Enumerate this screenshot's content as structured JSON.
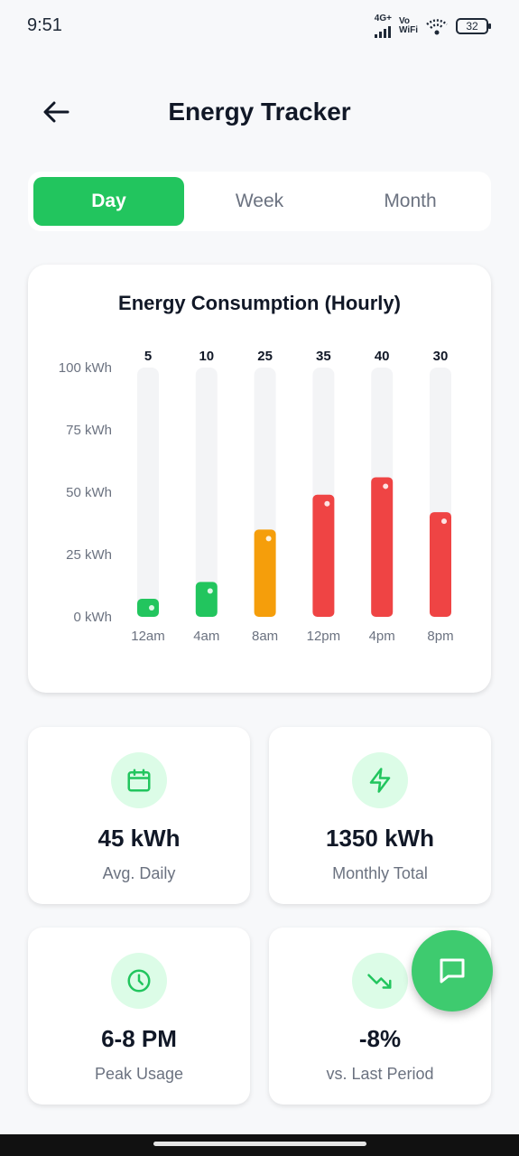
{
  "status_bar": {
    "time": "9:51",
    "network": "4G+",
    "wifi_label_1": "Vo",
    "wifi_label_2": "WiFi",
    "battery": "32"
  },
  "header": {
    "title": "Energy Tracker",
    "back_icon": "arrow-left-icon"
  },
  "tabs": [
    {
      "label": "Day",
      "active": true
    },
    {
      "label": "Week",
      "active": false
    },
    {
      "label": "Month",
      "active": false
    }
  ],
  "chart_data": {
    "type": "bar",
    "title": "Energy Consumption (Hourly)",
    "categories": [
      "12am",
      "4am",
      "8am",
      "12pm",
      "4pm",
      "8pm"
    ],
    "values": [
      5,
      10,
      25,
      35,
      40,
      30
    ],
    "y_ticks": [
      "100 kWh",
      "75 kWh",
      "50 kWh",
      "25 kWh",
      "0 kWh"
    ],
    "ylim": [
      0,
      100
    ],
    "grid": false,
    "bar_fill_fraction": [
      0.07,
      0.14,
      0.35,
      0.49,
      0.56,
      0.42
    ],
    "colors": {
      "low": "#22c55e",
      "medium": "#f59e0b",
      "high": "#ef4444",
      "track": "#f3f4f6"
    },
    "bar_colors": [
      "#22c55e",
      "#22c55e",
      "#f59e0b",
      "#ef4444",
      "#ef4444",
      "#ef4444"
    ]
  },
  "stats": [
    {
      "icon": "calendar-icon",
      "value": "45 kWh",
      "label": "Avg. Daily"
    },
    {
      "icon": "lightning-icon",
      "value": "1350 kWh",
      "label": "Monthly Total"
    },
    {
      "icon": "clock-icon",
      "value": "6-8 PM",
      "label": "Peak Usage"
    },
    {
      "icon": "trending-down-icon",
      "value": "-8%",
      "label": "vs. Last Period"
    }
  ],
  "fab": {
    "icon": "chat-icon"
  },
  "colors": {
    "accent": "#22c55e",
    "icon_bg": "#dcfce7",
    "fab": "#3ecb6f"
  }
}
